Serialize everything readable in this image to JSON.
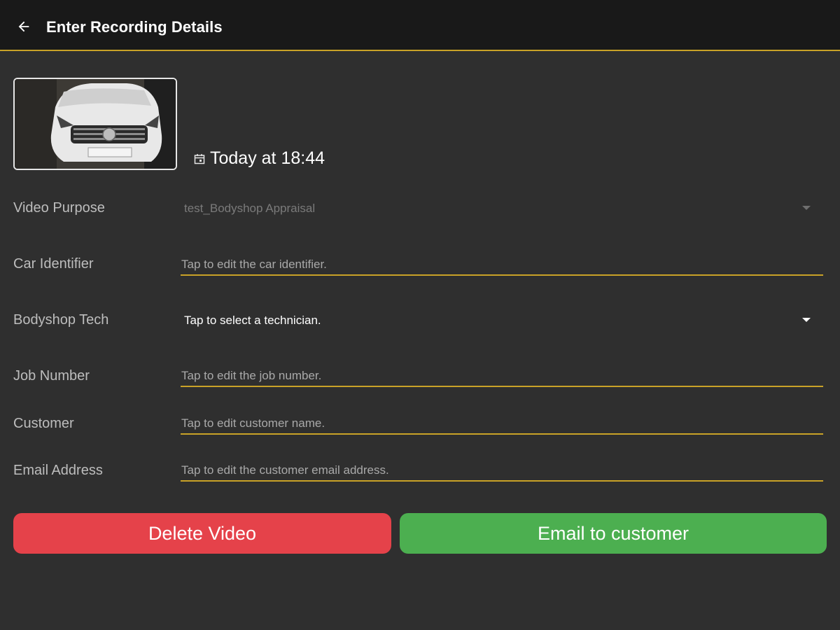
{
  "appbar": {
    "title": "Enter Recording Details"
  },
  "recording": {
    "timestamp": "Today at 18:44"
  },
  "form": {
    "video_purpose": {
      "label": "Video Purpose",
      "value": "test_Bodyshop Appraisal"
    },
    "car_identifier": {
      "label": "Car Identifier",
      "placeholder": "Tap to edit the car identifier."
    },
    "bodyshop_tech": {
      "label": "Bodyshop Tech",
      "value": "Tap to select a technician."
    },
    "job_number": {
      "label": "Job Number",
      "placeholder": "Tap to edit the job number."
    },
    "customer": {
      "label": "Customer",
      "placeholder": "Tap to edit customer name."
    },
    "email_address": {
      "label": "Email Address",
      "placeholder": "Tap to edit the customer email address."
    }
  },
  "actions": {
    "delete_label": "Delete Video",
    "email_label": "Email to customer"
  },
  "icons": {
    "back": "arrow-left-icon",
    "calendar": "calendar-icon",
    "dropdown": "caret-down-icon"
  },
  "colors": {
    "accent": "#c9a227",
    "delete": "#e5424a",
    "email": "#4caf50",
    "background": "#2f2f2f",
    "appbar": "#191919"
  }
}
